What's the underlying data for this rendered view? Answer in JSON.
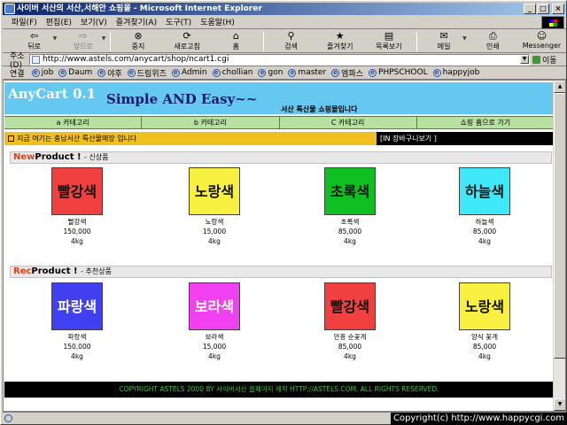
{
  "window": {
    "title": "사이버 서산의 서산,서해안 쇼핑몰 - Microsoft Internet Explorer",
    "min_label": "_",
    "max_label": "□",
    "close_label": "×"
  },
  "menu": [
    "파일(F)",
    "편집(E)",
    "보기(V)",
    "즐겨찾기(A)",
    "도구(T)",
    "도움말(H)"
  ],
  "toolbar": [
    {
      "label": "뒤로",
      "icon": "back-arrow-icon",
      "disabled": false
    },
    {
      "label": "앞으로",
      "icon": "forward-arrow-icon",
      "disabled": true
    },
    {
      "label": "중지",
      "icon": "stop-icon",
      "disabled": false
    },
    {
      "label": "새로고침",
      "icon": "refresh-icon",
      "disabled": false
    },
    {
      "label": "홈",
      "icon": "home-icon",
      "disabled": false
    },
    {
      "label": "검색",
      "icon": "search-icon",
      "disabled": false
    },
    {
      "label": "즐겨찾기",
      "icon": "favorites-icon",
      "disabled": false
    },
    {
      "label": "목록보기",
      "icon": "history-icon",
      "disabled": false
    },
    {
      "label": "메일",
      "icon": "mail-icon",
      "disabled": false
    },
    {
      "label": "인쇄",
      "icon": "print-icon",
      "disabled": false
    },
    {
      "label": "Messenger",
      "icon": "messenger-icon",
      "disabled": false
    }
  ],
  "address": {
    "label": "주소(D)",
    "url": "http://www.astels.com/anycart/shop/ncart1.cgi",
    "go_label": "이동"
  },
  "links": {
    "label": "연결",
    "items": [
      "job",
      "Daum",
      "야후",
      "드림위즈",
      "Admin",
      "chollian",
      "gon",
      "master",
      "엠파스",
      "PHPSCHOOL",
      "happyjob"
    ]
  },
  "page": {
    "logo": "AnyCart 0.1",
    "slogan": "Simple AND Easy~~",
    "subtitle": "서산 특산물 쇼핑몰입니다",
    "categories": [
      "a 카테고리",
      "b 카테고리",
      "C 카테고리",
      "쇼핑 홈으로 가기"
    ],
    "notice": "지금 여기는 충남서산 특산물매장 입니다",
    "cart_link": "[IN 장바구니보기 ]",
    "new_section": {
      "accent": "New",
      "rest": "Product ! ",
      "ko": "- 신상품"
    },
    "rec_section": {
      "accent": "Rec",
      "rest": "Product ! ",
      "ko": "- 추천상품"
    },
    "new_products": [
      {
        "img_text": "빨강색",
        "name": "빨강색",
        "price": "150,000",
        "weight": "4kg",
        "color": "#f04040"
      },
      {
        "img_text": "노랑색",
        "name": "노랑색",
        "price": "15,000",
        "weight": "4kg",
        "color": "#f8f040"
      },
      {
        "img_text": "초록색",
        "name": "초록색",
        "price": "85,000",
        "weight": "4kg",
        "color": "#10c020"
      },
      {
        "img_text": "하늘색",
        "name": "하늘색",
        "price": "85,000",
        "weight": "4kg",
        "color": "#40e8f8"
      }
    ],
    "rec_products": [
      {
        "img_text": "파랑색",
        "name": "파랑색",
        "price": "150,000",
        "weight": "4kg",
        "color": "#4040f0",
        "light": true
      },
      {
        "img_text": "보라색",
        "name": "보라색",
        "price": "15,000",
        "weight": "4kg",
        "color": "#f040f0",
        "light": true
      },
      {
        "img_text": "빨강색",
        "name": "안흥 순꽃게",
        "price": "85,000",
        "weight": "4kg",
        "color": "#f04040"
      },
      {
        "img_text": "노랑색",
        "name": "양식 꽃게",
        "price": "85,000",
        "weight": "4kg",
        "color": "#f8f040"
      }
    ],
    "footer": "COPYRIGHT ASTELS 2000 BY 사이버서산 홈페이지 제작 HTTP://ASTELS.COM. ALL RIGHTS RESERVED."
  },
  "watermark": "Copyright(c) http://www.happycgi.com"
}
